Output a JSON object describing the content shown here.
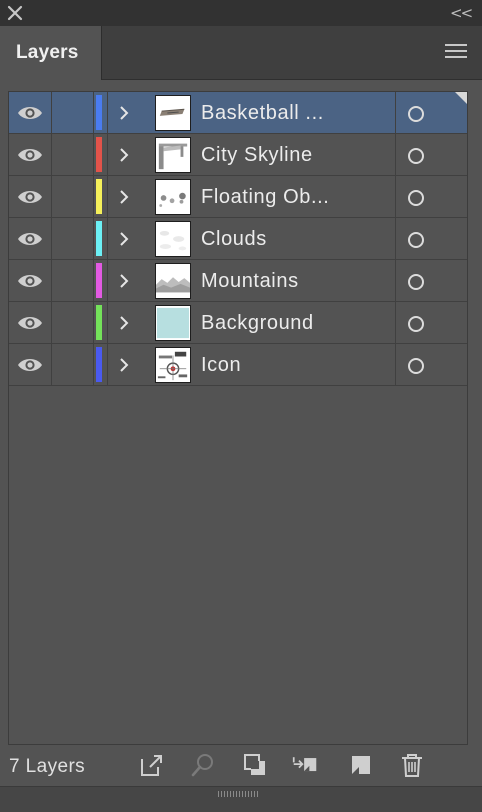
{
  "window": {
    "close_icon": "close-x-icon",
    "collapse_label": "<<"
  },
  "panel": {
    "tab_label": "Layers",
    "menu_icon": "hamburger-menu-icon"
  },
  "layers": [
    {
      "name": "Basketball ...",
      "color": "#4a7cf0",
      "selected": true,
      "thumb": "basketball"
    },
    {
      "name": "City Skyline",
      "color": "#e2534a",
      "selected": false,
      "thumb": "skyline"
    },
    {
      "name": "Floating Ob...",
      "color": "#f5f05a",
      "selected": false,
      "thumb": "floating"
    },
    {
      "name": "Clouds",
      "color": "#6cf0f5",
      "selected": false,
      "thumb": "clouds"
    },
    {
      "name": "Mountains",
      "color": "#e25ae2",
      "selected": false,
      "thumb": "mountains"
    },
    {
      "name": "Background",
      "color": "#74e25a",
      "selected": false,
      "thumb": "background"
    },
    {
      "name": "Icon",
      "color": "#4a5af0",
      "selected": false,
      "thumb": "icon"
    }
  ],
  "footer": {
    "count_label": "7 Layers",
    "buttons": [
      "export-icon",
      "locate-object-icon",
      "clipping-mask-icon",
      "move-to-layer-icon",
      "new-sublayer-icon",
      "trash-icon"
    ]
  }
}
